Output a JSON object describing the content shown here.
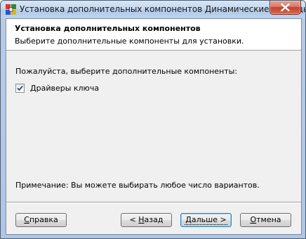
{
  "window": {
    "title": "Установка дополнительных компонентов Динамические таблицы"
  },
  "header": {
    "title": "Установка дополнительных компонентов",
    "subtitle": "Выберите дополнительные компоненты для  установки."
  },
  "body": {
    "prompt": "Пожалуйста, выберите дополнительные компоненты:",
    "components": [
      {
        "label": "Драйверы ключа",
        "checked": true
      }
    ],
    "note": "Примечание: Вы можете выбирать любое число вариантов."
  },
  "buttons": {
    "help": {
      "accel": "С",
      "rest": "правка"
    },
    "back": {
      "prefix": "< ",
      "accel": "Н",
      "rest": "азад"
    },
    "next": {
      "text": "Дальше >"
    },
    "cancel": {
      "accel": "О",
      "rest": "тмена"
    }
  },
  "colors": {
    "titlebar": "#c3d7ee",
    "close_button": "#c4412e",
    "dialog_background": "#f0f0f0",
    "default_button_border": "#3c7fb1"
  },
  "icons": {
    "app": "app-icon",
    "close": "close-icon",
    "check": "checkmark-icon"
  }
}
